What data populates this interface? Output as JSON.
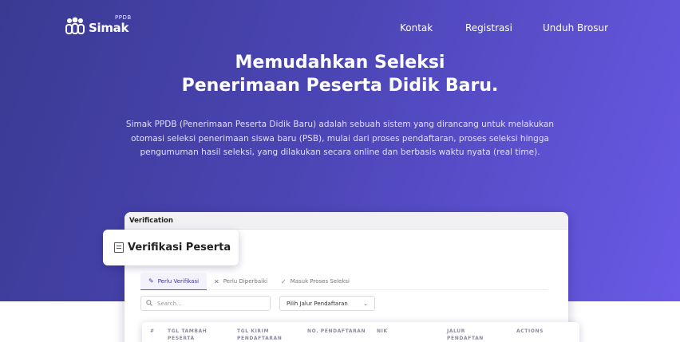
{
  "brand": {
    "name": "Simak",
    "sup": "PPDB"
  },
  "nav": {
    "items": [
      "Kontak",
      "Registrasi",
      "Unduh Brosur"
    ]
  },
  "hero": {
    "title_line1": "Memudahkan Seleksi",
    "title_line2": "Penerimaan Peserta Didik Baru.",
    "desc_line1": "Simak PPDB (Penerimaan Peserta Didik Baru) adalah sebuah sistem yang dirancang untuk melakukan",
    "desc_line2": "otomasi seleksi penerimaan siswa baru (PSB), mulai dari proses pendaftaran, proses seleksi hingga",
    "desc_line3": "pengumuman hasil seleksi, yang dilakukan secara online dan berbasis waktu nyata (real time)."
  },
  "preview": {
    "window_title": "Verification",
    "badge_title": "Verifikasi Peserta",
    "tabs": [
      "Perlu Verifikasi",
      "Perlu Diperbaiki",
      "Masuk Proses Seleksi"
    ],
    "search_placeholder": "Search...",
    "select_value": "Pilih Jalur Pendaftaran",
    "columns": [
      "#",
      "TGL TAMBAH PESERTA",
      "TGL KIRIM PENDAFTARAN",
      "NO. PENDAFTARAN",
      "NIK",
      "JALUR PENDAFTAN",
      "ACTIONS"
    ],
    "accent": "#5a4fd0"
  }
}
